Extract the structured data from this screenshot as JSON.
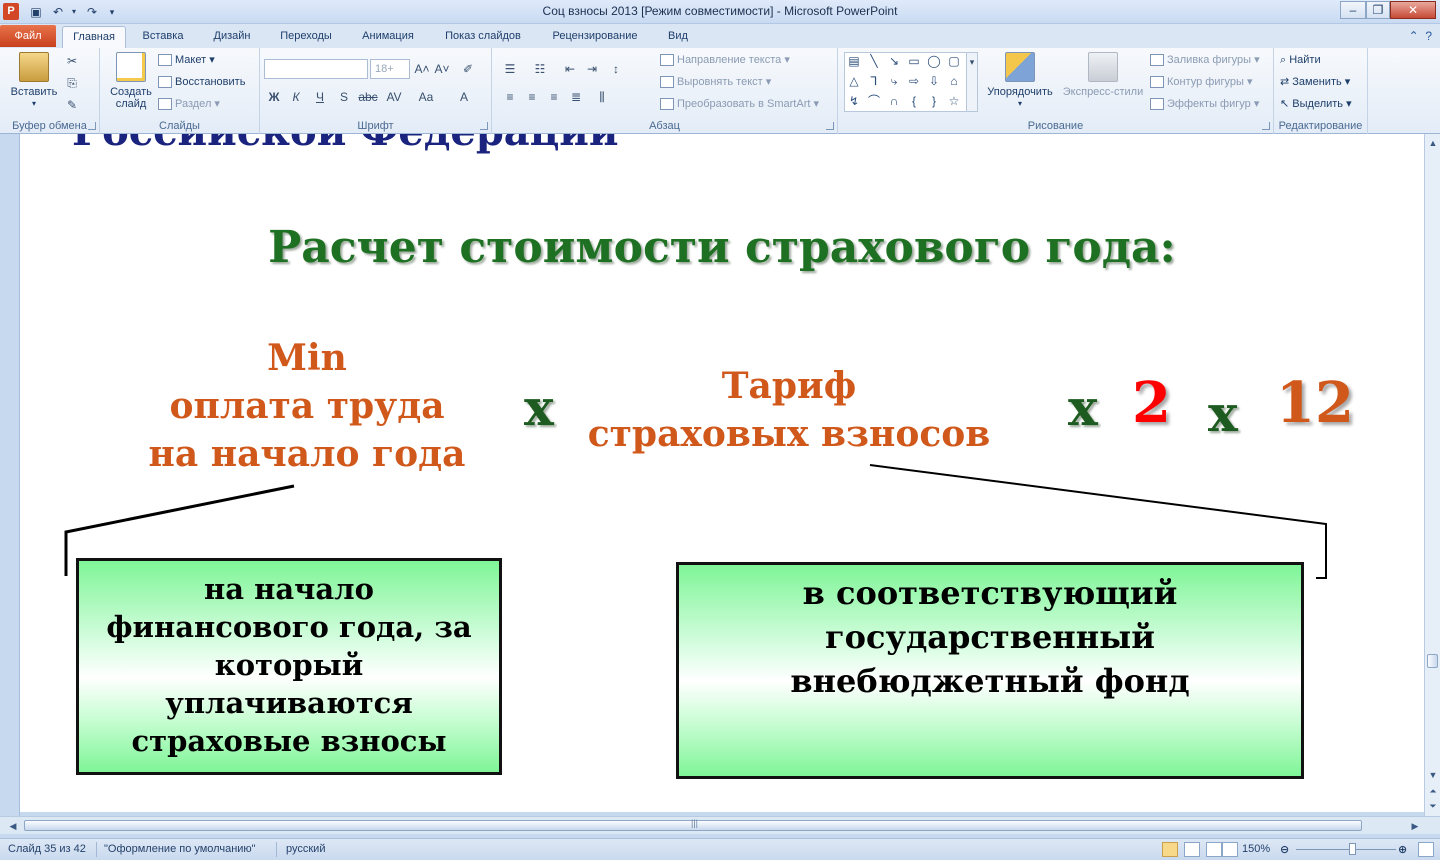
{
  "window": {
    "title": "Соц взносы 2013 [Режим совместимости]  -  Microsoft PowerPoint",
    "app_letter": "P"
  },
  "tabs": {
    "file": "Файл",
    "items": [
      "Главная",
      "Вставка",
      "Дизайн",
      "Переходы",
      "Анимация",
      "Показ слайдов",
      "Рецензирование",
      "Вид"
    ],
    "active": "Главная"
  },
  "ribbon": {
    "clipboard": {
      "label": "Буфер обмена",
      "paste": "Вставить"
    },
    "slides": {
      "label": "Слайды",
      "new_slide_1": "Создать",
      "new_slide_2": "слайд",
      "layout": "Макет",
      "reset": "Восстановить",
      "section": "Раздел"
    },
    "font": {
      "label": "Шрифт",
      "font_name": "",
      "font_size": "18+"
    },
    "paragraph": {
      "label": "Абзац",
      "text_direction": "Направление текста",
      "align_text": "Выровнять текст",
      "smartart": "Преобразовать в SmartArt"
    },
    "drawing": {
      "label": "Рисование",
      "arrange": "Упорядочить",
      "quick_styles": "Экспресс-стили",
      "shape_fill": "Заливка фигуры",
      "shape_outline": "Контур фигуры",
      "shape_effects": "Эффекты фигур"
    },
    "editing": {
      "label": "Редактирование",
      "find": "Найти",
      "replace": "Заменить",
      "select": "Выделить"
    }
  },
  "slide": {
    "clipped_heading": "Российской Федерации",
    "title": "Расчет стоимости страхового года:",
    "left_term": [
      "Min",
      "оплата труда",
      "на начало года"
    ],
    "times": "х",
    "middle_term": [
      "Тариф",
      "страховых взносов"
    ],
    "two": "2",
    "twelve": "12",
    "left_box": [
      "на начало",
      "финансового года, за",
      "который",
      "уплачиваются",
      "страховые взносы"
    ],
    "right_box": [
      "в соответствующий",
      "государственный",
      "внебюджетный фонд"
    ]
  },
  "colors": {
    "title_green": "#1e7022",
    "orange": "#d0581b",
    "red": "#ff0000",
    "box_green": "#7ff597"
  },
  "statusbar": {
    "slide_info": "Слайд 35 из 42",
    "theme": "\"Оформление по умолчанию\"",
    "language": "русский",
    "zoom": "150%"
  }
}
